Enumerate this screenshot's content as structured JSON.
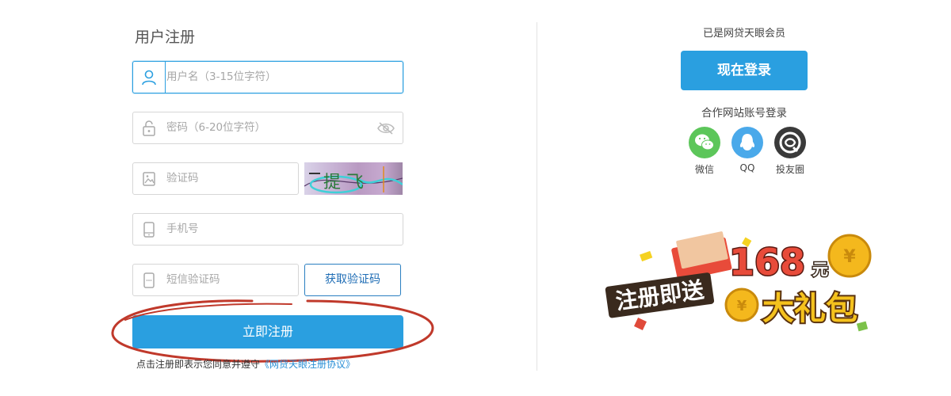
{
  "form": {
    "title": "用户注册",
    "username_placeholder": "用户名（3-15位字符）",
    "password_placeholder": "密码（6-20位字符）",
    "captcha_placeholder": "验证码",
    "captcha_text": "提 飞",
    "phone_placeholder": "手机号",
    "sms_placeholder": "短信验证码",
    "sms_button": "获取验证码",
    "submit_button": "立即注册",
    "agreement_prefix": "点击注册即表示您同意并遵守",
    "agreement_link": "《网贷天眼注册协议》"
  },
  "side": {
    "member_text": "已是网贷天眼会员",
    "login_button": "现在登录",
    "partner_title": "合作网站账号登录",
    "social": [
      {
        "label": "微信",
        "icon": "wechat-icon",
        "color": "#5cc65a"
      },
      {
        "label": "QQ",
        "icon": "qq-icon",
        "color": "#4aa9ea"
      },
      {
        "label": "投友圈",
        "icon": "touyouquan-icon",
        "color": "#3a3a3a"
      }
    ]
  },
  "promo": {
    "prefix": "注册即送",
    "amount": "168",
    "unit": "元",
    "suffix": "大礼包"
  },
  "colors": {
    "accent": "#2a9fe0",
    "annotation": "#c0392b"
  }
}
